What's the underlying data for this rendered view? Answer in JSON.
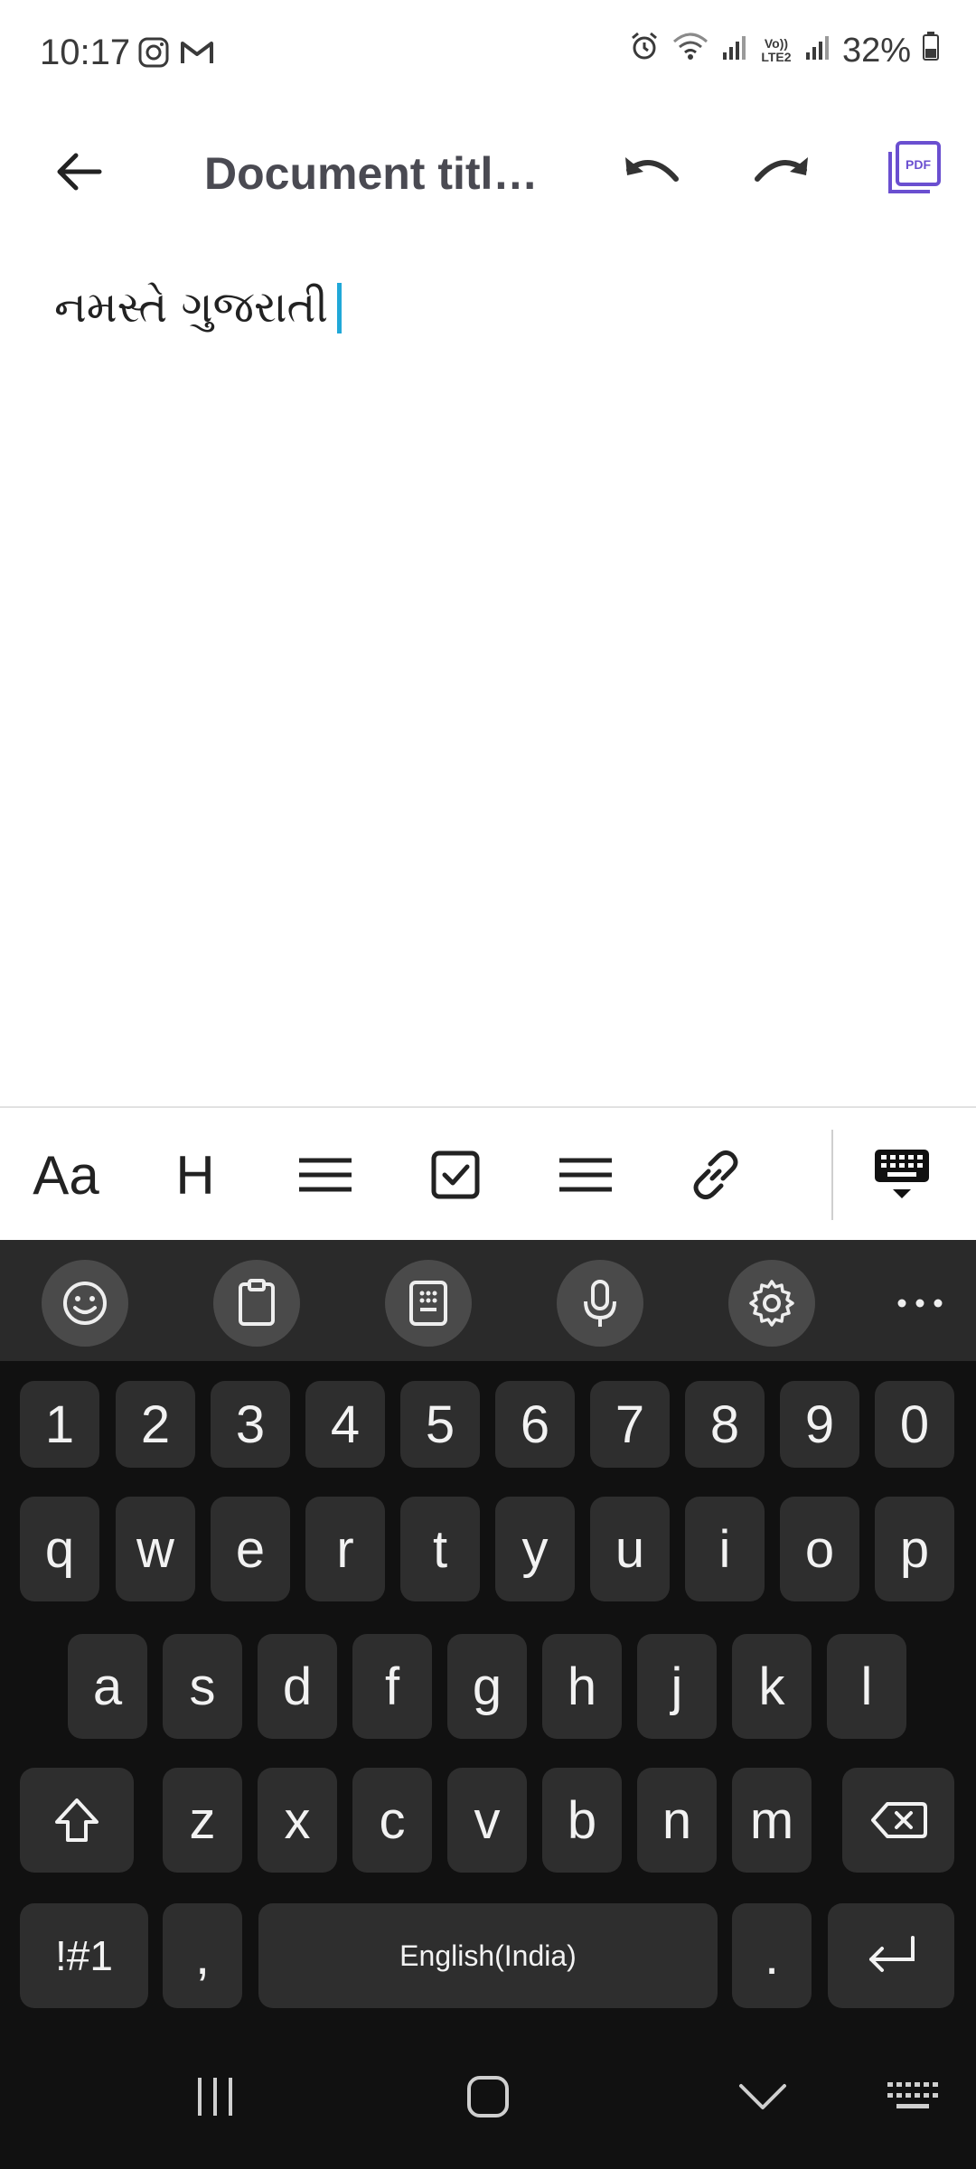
{
  "status_bar": {
    "time": "10:17",
    "battery": "32%",
    "network_label": "Vo)) LTE2"
  },
  "app_bar": {
    "title": "Document titl…"
  },
  "editor": {
    "text": "નમસ્તે ગુજરાતી"
  },
  "format_toolbar": {
    "text_style": "Aa",
    "heading": "H"
  },
  "keyboard": {
    "number_row": [
      "1",
      "2",
      "3",
      "4",
      "5",
      "6",
      "7",
      "8",
      "9",
      "0"
    ],
    "row1": [
      "q",
      "w",
      "e",
      "r",
      "t",
      "y",
      "u",
      "i",
      "o",
      "p"
    ],
    "row2": [
      "a",
      "s",
      "d",
      "f",
      "g",
      "h",
      "j",
      "k",
      "l"
    ],
    "row3": [
      "z",
      "x",
      "c",
      "v",
      "b",
      "n",
      "m"
    ],
    "symbols_key": "!#1",
    "comma_key": ",",
    "space_label": "English(India)",
    "period_key": "."
  },
  "colors": {
    "accent_pdf": "#6a4fd0",
    "caret": "#20a8d8",
    "keyboard_bg": "#111111",
    "key_bg": "#2e2e2e"
  }
}
